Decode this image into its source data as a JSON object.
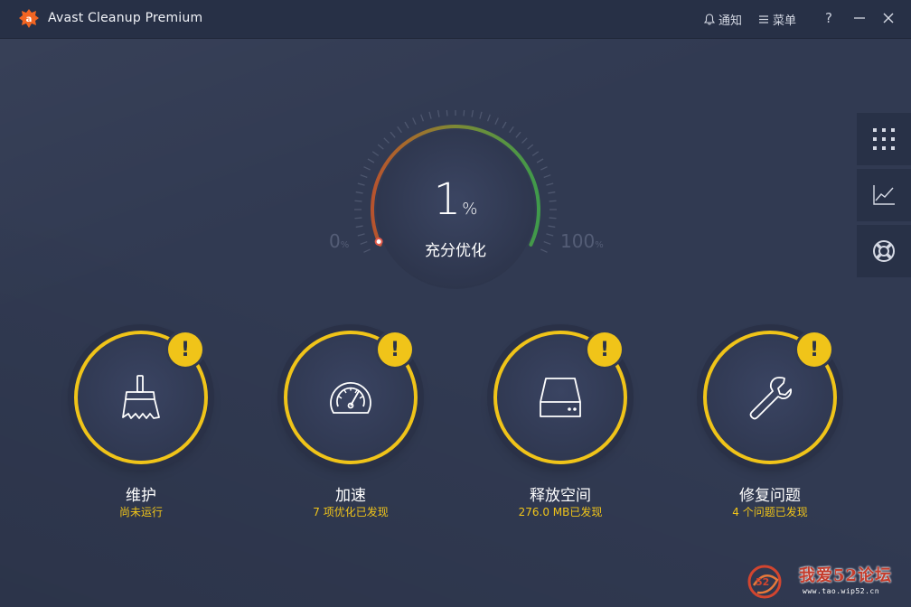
{
  "window": {
    "title": "Avast Cleanup Premium",
    "notify_label": "通知",
    "menu_label": "菜单",
    "help_label": "?",
    "accent_color": "#f0c419"
  },
  "gauge": {
    "value": "1",
    "unit": "%",
    "caption": "充分优化",
    "min_label": "0",
    "max_label": "100",
    "min_unit": "%",
    "max_unit": "%",
    "percent_value": 1
  },
  "side_panel": {
    "items": [
      {
        "icon": "grid-icon"
      },
      {
        "icon": "chart-icon"
      },
      {
        "icon": "lifebuoy-icon"
      }
    ]
  },
  "tiles": [
    {
      "label": "维护",
      "status": "尚未运行",
      "icon": "broom-icon",
      "badge": "!"
    },
    {
      "label": "加速",
      "status": "7 项优化已发现",
      "icon": "speedometer-icon",
      "badge": "!"
    },
    {
      "label": "释放空间",
      "status": "276.0 MB已发现",
      "icon": "drive-icon",
      "badge": "!"
    },
    {
      "label": "修复问题",
      "status": "4 个问题已发现",
      "icon": "wrench-icon",
      "badge": "!"
    }
  ],
  "watermark": {
    "text": "我爱52论坛",
    "sub": "www.tao.wip52.cn"
  }
}
